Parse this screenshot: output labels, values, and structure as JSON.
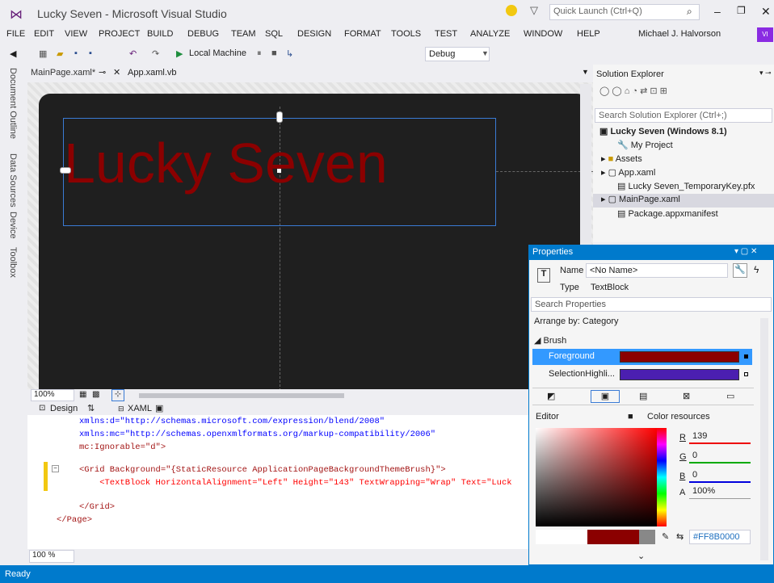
{
  "window": {
    "title": "Lucky Seven - Microsoft Visual Studio",
    "quick_launch_placeholder": "Quick Launch (Ctrl+Q)"
  },
  "menu": [
    "FILE",
    "EDIT",
    "VIEW",
    "PROJECT",
    "BUILD",
    "DEBUG",
    "TEAM",
    "SQL",
    "DESIGN",
    "FORMAT",
    "TOOLS",
    "TEST",
    "ANALYZE",
    "WINDOW",
    "HELP"
  ],
  "user": "Michael J. Halvorson",
  "user_initials": "VI",
  "toolbar": {
    "run_target": "Local Machine",
    "config": "Debug"
  },
  "left_tabs": [
    "Document Outline",
    "Data Sources",
    "Device",
    "Toolbox"
  ],
  "doc_tabs": {
    "active": "MainPage.xaml*",
    "other": "App.xaml.vb"
  },
  "designer": {
    "text": "Lucky Seven",
    "zoom": "100%"
  },
  "split": {
    "design": "Design",
    "xaml": "XAML"
  },
  "xaml_lines": [
    "xmlns:d=\"http://schemas.microsoft.com/expression/blend/2008\"",
    "xmlns:mc=\"http://schemas.openxmlformats.org/markup-compatibility/2006\"",
    "mc:Ignorable=\"d\">",
    "",
    "<Grid Background=\"{StaticResource ApplicationPageBackgroundThemeBrush}\">",
    "    <TextBlock HorizontalAlignment=\"Left\" Height=\"143\" TextWrapping=\"Wrap\" Text=\"Luck",
    "",
    "</Grid>",
    "</Page>"
  ],
  "bottom_zoom": "100 %",
  "status": "Ready",
  "solution": {
    "title": "Solution Explorer",
    "search_placeholder": "Search Solution Explorer (Ctrl+;)",
    "items": [
      "Lucky Seven (Windows 8.1)",
      "My Project",
      "Assets",
      "App.xaml",
      "Lucky Seven_TemporaryKey.pfx",
      "MainPage.xaml",
      "Package.appxmanifest"
    ]
  },
  "properties": {
    "title": "Properties",
    "name_label": "Name",
    "name_value": "<No Name>",
    "type_label": "Type",
    "type_value": "TextBlock",
    "search_placeholder": "Search Properties",
    "arrange": "Arrange by: Category",
    "category": "Brush",
    "foreground": "Foreground",
    "selection": "SelectionHighli...",
    "editor": "Editor",
    "color_resources": "Color resources",
    "r_label": "R",
    "r": "139",
    "g_label": "G",
    "g": "0",
    "b_label": "B",
    "b": "0",
    "a_label": "A",
    "a": "100%",
    "hex": "#FF8B0000"
  },
  "colors": {
    "accent": "#007ACC",
    "foreground": "#8B0000",
    "selection": "#4B1FB0"
  }
}
